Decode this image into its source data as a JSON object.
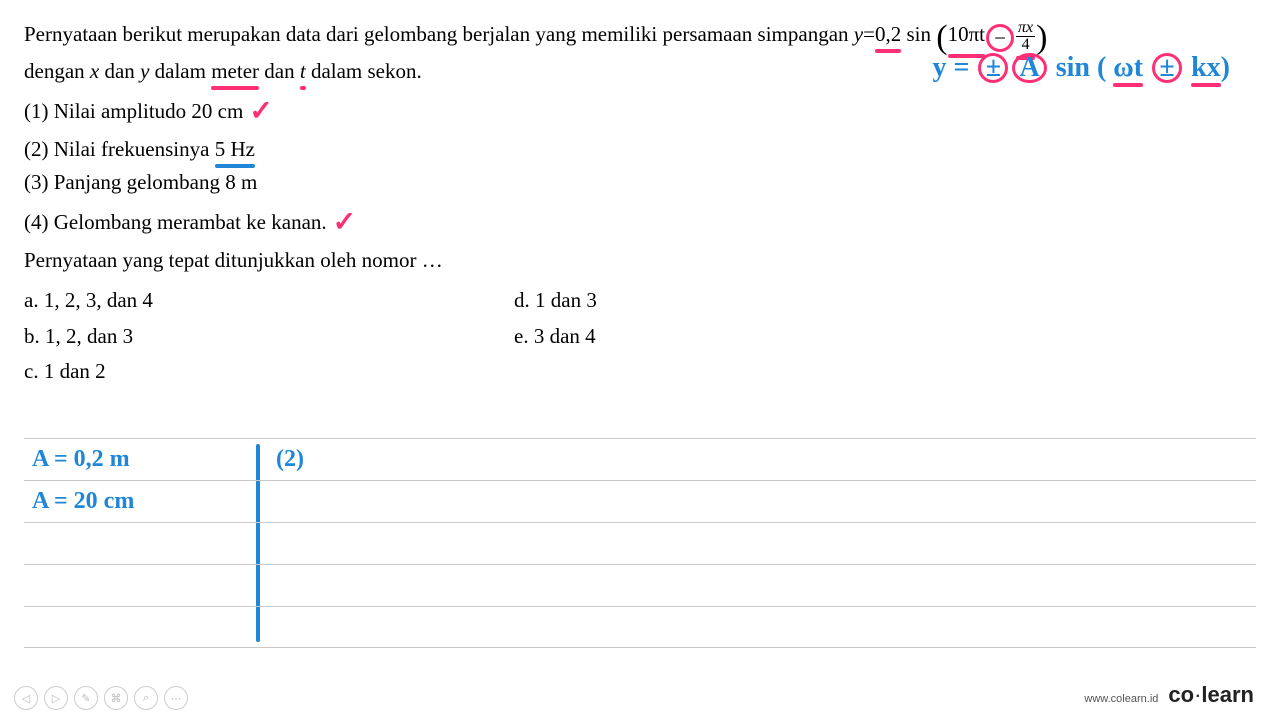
{
  "question": {
    "intro_a": "Pernyataan berikut merupakan data dari gelombang berjalan yang memiliki persamaan simpangan ",
    "eq_y": "y",
    "eq_eq": "=",
    "eq_coef": "0,2",
    "eq_sin": " sin ",
    "eq_paren_l": "(",
    "eq_inner_a": "10πt",
    "eq_minus": "−",
    "frac_num": "πx",
    "frac_den": "4",
    "eq_paren_r": ")",
    "intro_b_1": "dengan ",
    "intro_b_x": "x",
    "intro_b_2": " dan ",
    "intro_b_y": "y",
    "intro_b_3": " dalam ",
    "intro_b_meter": "meter",
    "intro_b_4": " dan ",
    "intro_b_t": "t",
    "intro_b_5": " dalam sekon."
  },
  "statements": {
    "s1_num": "(1) ",
    "s1_text": "Nilai amplitudo 20 cm",
    "s1_check": "✓",
    "s2_num": "(2) ",
    "s2_text_a": "Nilai frekuensinya ",
    "s2_text_b": "5 Hz",
    "s3_num": "(3) ",
    "s3_text": "Panjang gelombang 8 m",
    "s4_num": "(4) ",
    "s4_text": "Gelombang merambat ke kanan.",
    "s4_check": "✓"
  },
  "prompt": "Pernyataan yang tepat ditunjukkan oleh nomor …",
  "options": {
    "a": "a. 1, 2, 3, dan 4",
    "b": "b. 1, 2, dan 3",
    "c": "c. 1 dan 2",
    "d": "d. 1 dan 3",
    "e": "e. 3 dan 4"
  },
  "hand_formula": {
    "y": "y",
    "eq": "=",
    "pm1": "±",
    "A": "A",
    "sin": "sin",
    "lp": "(",
    "wt": "ωt",
    "pm2": "±",
    "kx": "kx",
    "rp": ")"
  },
  "notebook": {
    "r1_left": "A = 0,2 m",
    "r1_right": "(2)",
    "r2_left": "A =  20 cm"
  },
  "footer": {
    "url": "www.colearn.id",
    "brand_a": "co",
    "brand_dot": "·",
    "brand_b": "learn"
  },
  "icons": {
    "prev": "◁",
    "next": "▷",
    "edit": "✎",
    "cam": "⌘",
    "zoom": "⌕",
    "more": "⋯"
  }
}
